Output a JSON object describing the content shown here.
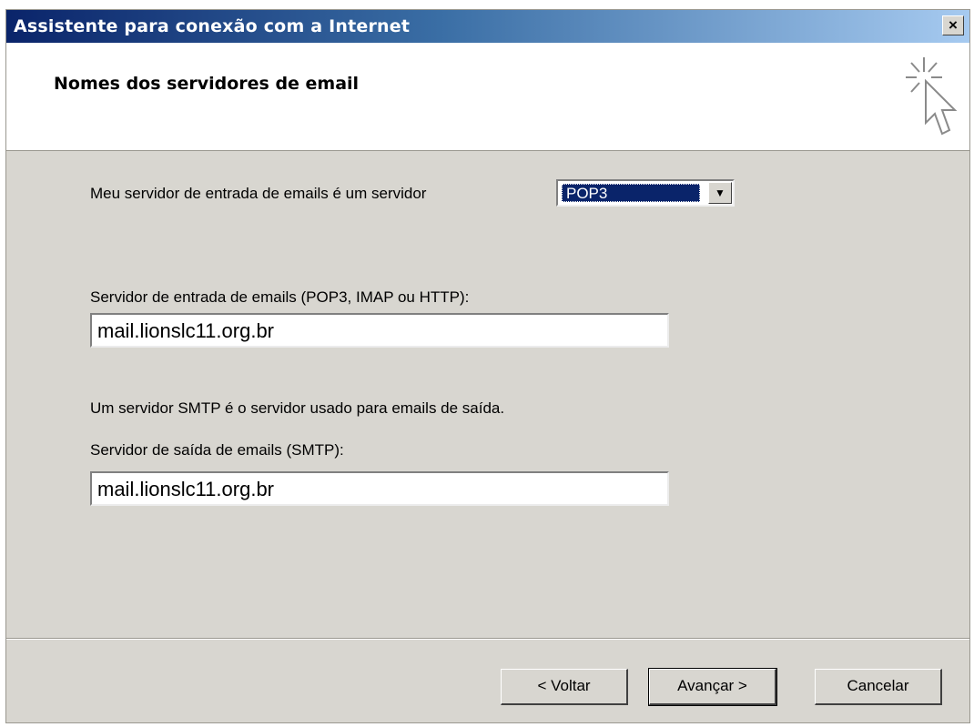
{
  "window": {
    "title": "Assistente para conexão com a Internet",
    "close_label": "×"
  },
  "header": {
    "title": "Nomes dos servidores de email",
    "icon": "wizard-cursor-sparkle-icon"
  },
  "form": {
    "incoming_type_label": "Meu servidor de entrada de emails é um servidor",
    "incoming_type_value": "POP3",
    "incoming_server_label": "Servidor de entrada de emails (POP3, IMAP ou HTTP):",
    "incoming_server_value": "mail.lionslc11.org.br",
    "smtp_info": "Um servidor SMTP é o servidor usado para emails de saída.",
    "outgoing_server_label": "Servidor de saída de emails (SMTP):",
    "outgoing_server_value": "mail.lionslc11.org.br"
  },
  "buttons": {
    "back": "< Voltar",
    "next": "Avançar >",
    "cancel": "Cancelar"
  },
  "colors": {
    "title_bar_start": "#0a246a",
    "title_bar_end": "#a6caf0",
    "dialog_bg": "#d8d6d0",
    "selection": "#0a246a"
  }
}
